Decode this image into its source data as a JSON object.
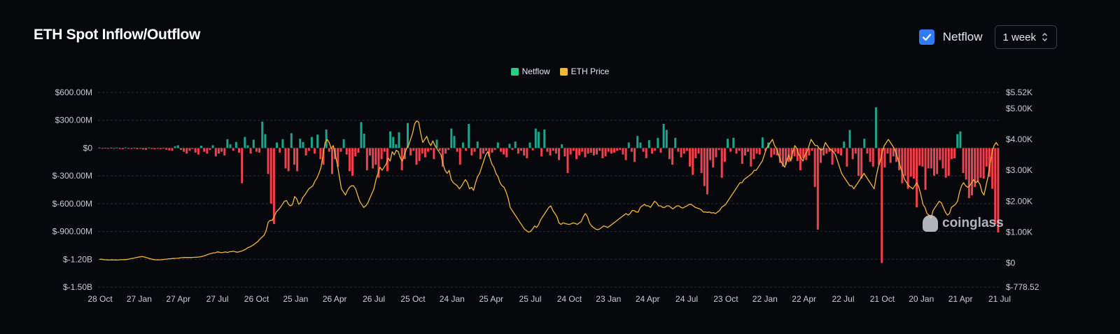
{
  "header": {
    "title": "ETH Spot Inflow/Outflow",
    "netflow_toggle_label": "Netflow",
    "netflow_checked": true,
    "interval_value": "1 week"
  },
  "watermark": "coinglass",
  "colors": {
    "inflow": "#1aa58c",
    "outflow": "#f0404d",
    "netflow_legend": "#2fc98a",
    "price": "#f0b73e",
    "grid": "#2a2d35",
    "checkbox": "#2f7cf6"
  },
  "chart_data": {
    "type": "bar",
    "title": "",
    "legend": [
      {
        "name": "Netflow",
        "color": "#2fc98a"
      },
      {
        "name": "ETH Price",
        "color": "#f0b73e"
      }
    ],
    "legend_position": "top-center",
    "x_ticks": [
      "28 Oct",
      "27 Jan",
      "27 Apr",
      "27 Jul",
      "26 Oct",
      "25 Jan",
      "26 Apr",
      "26 Jul",
      "25 Oct",
      "24 Jan",
      "25 Apr",
      "25 Jul",
      "24 Oct",
      "23 Jan",
      "24 Apr",
      "24 Jul",
      "23 Oct",
      "22 Jan",
      "22 Apr",
      "22 Jul",
      "21 Oct",
      "20 Jan",
      "21 Apr",
      "21 Jul"
    ],
    "y_left": {
      "ticks": [
        600000000,
        300000000,
        0,
        -300000000,
        -600000000,
        -900000000,
        -1200000000,
        -1500000000
      ],
      "tick_labels": [
        "$600.00M",
        "$300.00M",
        "$0",
        "$-300.00M",
        "$-600.00M",
        "$-900.00M",
        "$-1.20B",
        "$-1.50B"
      ],
      "range": [
        -1500000000,
        600000000
      ]
    },
    "y_right": {
      "ticks": [
        5520,
        5000,
        4000,
        3000,
        2000,
        1000,
        0,
        -778.52
      ],
      "tick_labels": [
        "$5.52K",
        "$5.00K",
        "$4.00K",
        "$3.00K",
        "$2.00K",
        "$1.00K",
        "$0",
        "$-778.52"
      ],
      "range": [
        -778.52,
        5520
      ]
    },
    "grid": true,
    "netflow_musd": [
      5,
      -5,
      3,
      -6,
      4,
      -8,
      5,
      -10,
      -12,
      6,
      -8,
      -10,
      4,
      -12,
      -6,
      -15,
      -20,
      5,
      -10,
      -14,
      -8,
      -12,
      3,
      -18,
      -25,
      -30,
      20,
      30,
      -20,
      -40,
      -60,
      -30,
      -10,
      -50,
      -70,
      25,
      -40,
      -60,
      -20,
      30,
      -90,
      -60,
      -40,
      -80,
      95,
      40,
      -30,
      65,
      -50,
      -380,
      120,
      30,
      -60,
      90,
      -40,
      -50,
      285,
      150,
      -280,
      -600,
      -820,
      60,
      -50,
      95,
      -220,
      -250,
      160,
      -180,
      -250,
      100,
      65,
      -80,
      -30,
      120,
      -60,
      145,
      -120,
      -180,
      200,
      -40,
      -280,
      -120,
      -200,
      -40,
      95,
      -70,
      -250,
      -300,
      -90,
      -50,
      280,
      155,
      -240,
      -80,
      -220,
      -180,
      -320,
      -120,
      -40,
      -250,
      180,
      120,
      40,
      170,
      -240,
      -120,
      270,
      -80,
      -30,
      -180,
      -140,
      -60,
      -100,
      -40,
      -20,
      -120,
      90,
      -30,
      -200,
      -60,
      -20,
      210,
      130,
      -40,
      -180,
      60,
      -30,
      260,
      -80,
      -40,
      70,
      -120,
      -60,
      -30,
      -90,
      -50,
      -20,
      60,
      -40,
      -70,
      -100,
      45,
      -20,
      70,
      -60,
      -30,
      -80,
      -110,
      60,
      -25,
      210,
      175,
      -90,
      200,
      -40,
      -80,
      -30,
      -60,
      -130,
      40,
      -90,
      -270,
      -70,
      -30,
      -120,
      -80,
      -40,
      -100,
      -60,
      -50,
      -80,
      -70,
      -30,
      -110,
      -90,
      -40,
      -60,
      -50,
      -30,
      -20,
      -70,
      -130,
      60,
      -40,
      -150,
      130,
      60,
      -40,
      -110,
      85,
      -60,
      -30,
      110,
      -50,
      260,
      195,
      -120,
      -180,
      110,
      -40,
      -100,
      -60,
      -30,
      -200,
      -290,
      -110,
      -60,
      -270,
      -410,
      -500,
      -130,
      -210,
      -100,
      -20,
      -320,
      -150,
      100,
      -40,
      110,
      -60,
      -30,
      -170,
      -80,
      -40,
      -200,
      -120,
      -60,
      -70,
      115,
      -30,
      60,
      -100,
      -70,
      -80,
      -160,
      -200,
      -180,
      -150,
      -120,
      -90,
      -140,
      -240,
      -110,
      -130,
      -80,
      -30,
      -420,
      -880,
      -160,
      -80,
      -60,
      -40,
      -180,
      -40,
      -60,
      -80,
      70,
      -200,
      195,
      -120,
      -60,
      -300,
      -330,
      100,
      -60,
      -150,
      -200,
      440,
      -180,
      -1240,
      -210,
      -60,
      -160,
      -90,
      -150,
      -240,
      -380,
      -300,
      -440,
      -310,
      -330,
      -640,
      -190,
      -200,
      -450,
      -220,
      -220,
      -300,
      -280,
      -130,
      -220,
      -320,
      -300,
      -120,
      -110,
      150,
      180,
      -270,
      -340,
      -540,
      -510,
      -420,
      -360,
      -320,
      -330,
      -200,
      -310,
      -440,
      -820,
      -910
    ],
    "price_usd": [
      120,
      125,
      110,
      105,
      100,
      98,
      102,
      100,
      98,
      96,
      105,
      108,
      110,
      112,
      120,
      135,
      150,
      160,
      175,
      190,
      200,
      210,
      195,
      180,
      160,
      140,
      120,
      110,
      105,
      100,
      105,
      110,
      118,
      125,
      135,
      140,
      145,
      150,
      152,
      160,
      170,
      175,
      180,
      178,
      180,
      178,
      182,
      186,
      190,
      195,
      205,
      225,
      240,
      270,
      290,
      310,
      330,
      330,
      360,
      350,
      335,
      345,
      360,
      340,
      365,
      370,
      380,
      360,
      350,
      370,
      385,
      420,
      450,
      500,
      520,
      560,
      600,
      650,
      700,
      780,
      840,
      900,
      1050,
      1320,
      1380,
      1380,
      1500,
      1650,
      1720,
      1800,
      1900,
      2000,
      2020,
      1900,
      1850,
      1900,
      2150,
      2080,
      1900,
      1960,
      2120,
      2200,
      2300,
      2400,
      2450,
      2500,
      2650,
      2750,
      2900,
      3100,
      3500,
      3900,
      4000,
      3900,
      3700,
      3800,
      3500,
      3200,
      2800,
      2400,
      2300,
      2200,
      2350,
      2450,
      2500,
      2500,
      2400,
      2200,
      2000,
      1900,
      1800,
      1850,
      1950,
      2100,
      2250,
      2400,
      2700,
      2900,
      3100,
      3000,
      3100,
      3200,
      3400,
      3300,
      3600,
      3500,
      3650,
      3600,
      3400,
      3300,
      3500,
      3700,
      3800,
      4000,
      4200,
      4500,
      4600,
      4560,
      4200,
      3900,
      4000,
      4100,
      3900,
      3800,
      3950,
      3800,
      3700,
      3600,
      3500,
      3200,
      3000,
      2900,
      3000,
      2700,
      2600,
      2550,
      2500,
      2400,
      2480,
      2600,
      2700,
      2600,
      2400,
      2450,
      2350,
      2600,
      2800,
      2900,
      3100,
      3300,
      3500,
      3600,
      3400,
      3200,
      3100,
      2900,
      2800,
      2600,
      2500,
      2450,
      2300,
      2100,
      1800,
      1700,
      1600,
      1500,
      1400,
      1300,
      1200,
      1100,
      1050,
      1000,
      1020,
      1100,
      1200,
      1150,
      1250,
      1400,
      1500,
      1600,
      1700,
      1800,
      1850,
      1700,
      1600,
      1500,
      1300,
      1250,
      1300,
      1280,
      1260,
      1250,
      1270,
      1300,
      1280,
      1250,
      1300,
      1350,
      1500,
      1600,
      1500,
      1300,
      1200,
      1150,
      1100,
      1080,
      1100,
      1150,
      1200,
      1180,
      1150,
      1200,
      1250,
      1300,
      1350,
      1400,
      1450,
      1500,
      1550,
      1600,
      1550,
      1600,
      1700,
      1700,
      1650,
      1650,
      1800,
      1850,
      1900,
      1850,
      1850,
      1800,
      1900,
      2000,
      1950,
      1850,
      1850,
      1800,
      1800,
      1850,
      1850,
      1800,
      1750,
      1800,
      1850,
      1850,
      1800,
      1780,
      1820,
      1850,
      1900,
      1900,
      1850,
      1800,
      1780,
      1760,
      1720,
      1650,
      1650,
      1640,
      1650,
      1620,
      1630,
      1600,
      1650,
      1700,
      1800,
      1850,
      1900,
      2000,
      2100,
      2200,
      2300,
      2400,
      2500,
      2600,
      2600,
      2700,
      2750,
      2800,
      2850,
      2900,
      3000,
      3000,
      3100,
      3200,
      3300,
      3500,
      3700,
      3800,
      3900,
      4000,
      3800,
      3700,
      3500,
      3300,
      3200,
      3100,
      3300,
      3500,
      3300,
      3600,
      3800,
      3700,
      3500,
      3400,
      3300,
      3500,
      3600,
      3800,
      4000,
      3900,
      3800,
      3800,
      3700,
      3650,
      3700,
      3900,
      3800,
      3700,
      3650,
      3600,
      3500,
      3300,
      3100,
      2900,
      2800,
      2700,
      2600,
      2500,
      2500,
      2400,
      2500,
      2600,
      2700,
      2800,
      2900,
      2800,
      2700,
      2600,
      2500,
      2400,
      2800,
      3100,
      3300,
      3600,
      3800,
      3900,
      4000,
      3900,
      3800,
      3700,
      3500,
      3300,
      3100,
      2900,
      2700,
      2600,
      2500,
      2450,
      2400,
      2500,
      2600,
      2450,
      2200,
      1900,
      1800,
      1600,
      1550,
      1450,
      1700,
      1800,
      1900,
      2000,
      1950,
      1800,
      1650,
      1550,
      1600,
      1800,
      1850,
      1900,
      2000,
      2300,
      2500,
      2600,
      2500,
      2450,
      2500,
      2600,
      2700,
      2600,
      2650,
      2550,
      2300,
      2200,
      2500,
      2800,
      3200,
      3600,
      3800,
      3900,
      3800
    ]
  }
}
